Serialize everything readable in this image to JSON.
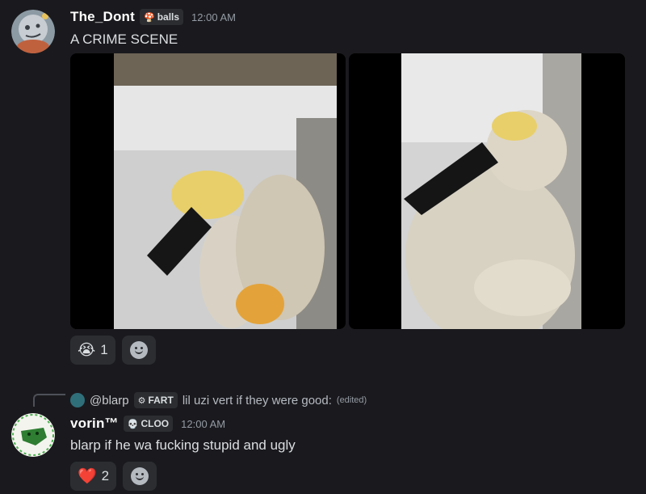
{
  "messages": [
    {
      "username": "The_Dont",
      "tag": {
        "icon": "mushroom",
        "label": "balls"
      },
      "timestamp": "12:00 AM",
      "text": "A CRIME SCENE",
      "attachments": [
        "video-frame-left",
        "video-frame-right"
      ],
      "reactions": [
        {
          "emoji": "😭",
          "count": "1"
        }
      ],
      "add_reaction_icon": "smile-add-reaction-icon"
    },
    {
      "reply": {
        "username": "@blarp",
        "tag": {
          "icon": "gear",
          "label": "FART"
        },
        "text": "lil uzi vert if they were good:",
        "edited": "(edited)"
      },
      "username": "vorin™",
      "tag": {
        "icon": "skull",
        "label": "CLOO"
      },
      "timestamp": "12:00 AM",
      "text": "blarp if he wa fucking stupid and ugly",
      "reactions": [
        {
          "emoji": "❤️",
          "count": "2"
        }
      ],
      "add_reaction_icon": "smile-add-reaction-icon"
    }
  ],
  "colors": {
    "background": "#1a1a1e",
    "username": "#ffffff",
    "muted": "#949ba4",
    "reaction_bg": "#2b2d31"
  }
}
